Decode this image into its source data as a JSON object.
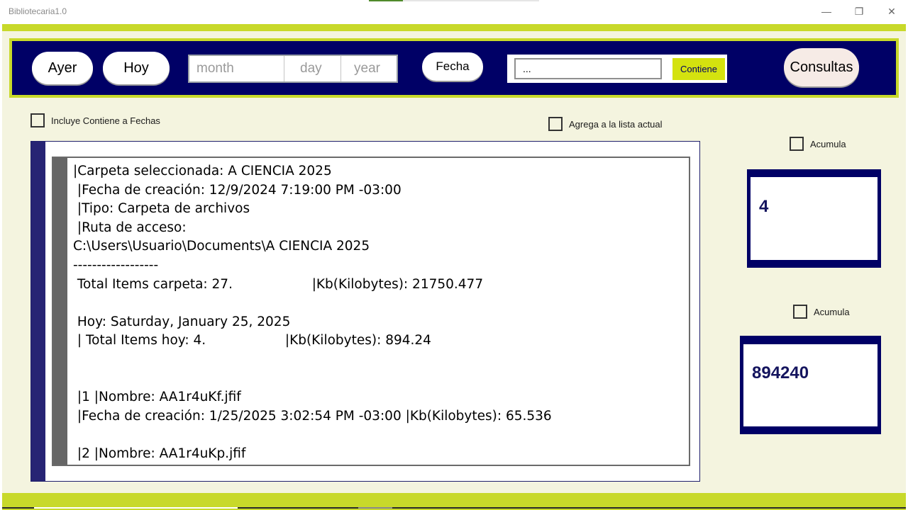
{
  "window": {
    "title": "Bibliotecaria1.0",
    "minimize_glyph": "—",
    "maximize_glyph": "❐",
    "close_glyph": "✕",
    "progress_fraction": 0.2
  },
  "colors": {
    "accent_lime": "#c8d92a",
    "toolbar_navy": "#000066",
    "background_cream": "#f4f4df"
  },
  "toolbar": {
    "ayer_label": "Ayer",
    "hoy_label": "Hoy",
    "date_picker": {
      "month_placeholder": "month",
      "day_placeholder": "day",
      "year_placeholder": "year"
    },
    "fecha_label": "Fecha",
    "search_value": "...",
    "contiene_label": "Contiene",
    "consultas_label": "Consultas"
  },
  "options": {
    "incluye_label": "Incluye Contiene a Fechas",
    "agrega_label": "Agrega a la lista actual"
  },
  "results": {
    "lines": [
      "|Carpeta seleccionada: A CIENCIA 2025",
      " |Fecha de creación: 12/9/2024 7:19:00 PM -03:00",
      " |Tipo: Carpeta de archivos",
      " |Ruta de acceso:",
      "C:\\Users\\Usuario\\Documents\\A CIENCIA 2025",
      "------------------",
      " Total Items carpeta: 27.                   |Kb(Kilobytes): 21750.477",
      "",
      " Hoy: Saturday, January 25, 2025",
      " | Total Items hoy: 4.                   |Kb(Kilobytes): 894.24",
      "",
      "",
      " |1 |Nombre: AA1r4uKf.jfif",
      " |Fecha de creación: 1/25/2025 3:02:54 PM -03:00 |Kb(Kilobytes): 65.536",
      "",
      " |2 |Nombre: AA1r4uKp.jfif"
    ]
  },
  "counters": {
    "acumula_1_label": "Acumula",
    "items_value": "4",
    "acumula_2_label": "Acumula",
    "kb_value": "894240"
  }
}
